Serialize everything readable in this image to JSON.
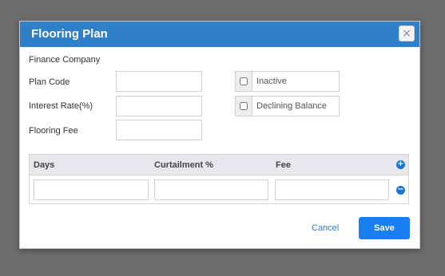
{
  "dialog": {
    "title": "Flooring Plan",
    "close_glyph": "×"
  },
  "form": {
    "finance_company_label": "Finance Company",
    "plan_code_label": "Plan Code",
    "plan_code_value": "",
    "interest_rate_label": "Interest Rate(%)",
    "interest_rate_value": "",
    "flooring_fee_label": "Flooring Fee",
    "flooring_fee_value": "",
    "inactive_label": "Inactive",
    "inactive_checked": false,
    "declining_balance_label": "Declining Balance",
    "declining_balance_checked": false
  },
  "grid": {
    "columns": [
      "Days",
      "Curtailment %",
      "Fee"
    ],
    "add_row_glyph": "+",
    "remove_row_glyph": "−",
    "rows": [
      {
        "days": "",
        "curtailment": "",
        "fee": ""
      }
    ]
  },
  "footer": {
    "cancel_label": "Cancel",
    "save_label": "Save"
  },
  "colors": {
    "titlebar": "#2f80c9",
    "primary_button": "#1a7ff0",
    "icon_accent": "#1a74d6",
    "overlay": "#6d6d6d"
  },
  "icons": {
    "close": "close-icon",
    "add_row": "plus-circle-icon",
    "remove_row": "minus-circle-icon"
  }
}
